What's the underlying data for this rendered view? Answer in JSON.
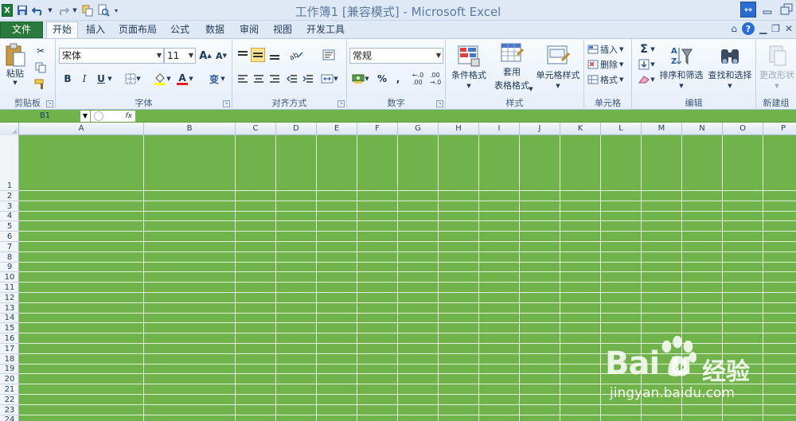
{
  "window": {
    "title": "工作簿1  [兼容模式] - Microsoft Excel",
    "logo_letter": "X"
  },
  "tabs": {
    "file": "文件",
    "items": [
      "开始",
      "插入",
      "页面布局",
      "公式",
      "数据",
      "审阅",
      "视图",
      "开发工具"
    ],
    "active": "开始"
  },
  "ribbon": {
    "clipboard": {
      "label": "剪贴板",
      "paste": "粘贴"
    },
    "font": {
      "label": "字体",
      "name": "宋体",
      "size": "11",
      "grow": "A",
      "shrink": "A",
      "bold": "B",
      "italic": "I",
      "underline": "U",
      "wen": "变"
    },
    "alignment": {
      "label": "对齐方式"
    },
    "number": {
      "label": "数字",
      "format": "常规",
      "percent": "%",
      "comma": ","
    },
    "styles": {
      "label": "样式",
      "conditional": "条件格式",
      "table_line1": "套用",
      "table_line2": "表格格式",
      "cell_styles": "单元格样式"
    },
    "cells": {
      "label": "单元格",
      "insert": "插入",
      "delete": "删除",
      "format": "格式"
    },
    "editing": {
      "label": "编辑",
      "sum": "Σ",
      "sort": "排序和筛选",
      "find": "查找和选择"
    },
    "new_group": {
      "label": "新建组",
      "change": "更改形状"
    }
  },
  "formula_bar": {
    "name_box": "B1",
    "fx": "fx"
  },
  "columns": [
    "A",
    "B",
    "C",
    "D",
    "E",
    "F",
    "G",
    "H",
    "I",
    "J",
    "K",
    "L",
    "M",
    "N",
    "O",
    "P"
  ],
  "rows": [
    "1",
    "2",
    "3",
    "4",
    "5",
    "6",
    "7",
    "8",
    "9",
    "10",
    "11",
    "12",
    "13",
    "14",
    "15",
    "16",
    "17",
    "18",
    "19",
    "20",
    "21",
    "22",
    "23",
    "24"
  ],
  "colors": {
    "cell_fill": "#70b34a",
    "file_tab": "#2a7a3b"
  },
  "watermark": {
    "brand": "Bai  u",
    "cn": "经验",
    "url": "jingyan.baidu.com"
  }
}
